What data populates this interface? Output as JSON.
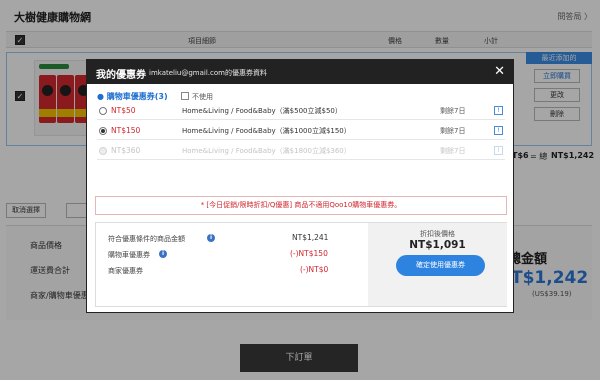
{
  "page": {
    "store_name": "大樹健康購物網",
    "store_link": "問答局 〉",
    "header": {
      "check": "✓",
      "item_info": "項目細節",
      "price": "價格",
      "quantity": "數量",
      "subtotal": "小計"
    },
    "item": {
      "check": "✓",
      "recent_tab": "最近添加的",
      "buy_now": "立即購買",
      "change": "更改",
      "delete": "刪除"
    },
    "total_line": {
      "prefix": "T$6",
      "equals": "= 總",
      "amount": "NT$1,242"
    },
    "deselect_button": "取消選擇",
    "summary": {
      "product_price": "商品價格",
      "shipping_total": "運送費合計",
      "store_coupon": "商家/購物車優惠",
      "grand_label": "總金額",
      "grand_amount": "T$1,242",
      "grand_usd": "(US$39.19)"
    },
    "order_button": "下訂單"
  },
  "modal": {
    "title": "我的優惠券",
    "email_text": "imkateliu@gmail.com的優惠券資料",
    "close": "✕",
    "section_title": "● 購物車優惠券(3)",
    "not_use": "不使用",
    "coupons": [
      {
        "code": "NT$50",
        "desc": "Home&Living / Food&Baby（滿$500立減$50）",
        "days": "剩餘7日",
        "selected": false,
        "disabled": false,
        "info": "!"
      },
      {
        "code": "NT$150",
        "desc": "Home&Living / Food&Baby（滿$1000立減$150）",
        "days": "剩餘7日",
        "selected": true,
        "disabled": false,
        "info": "!"
      },
      {
        "code": "NT$360",
        "desc": "Home&Living / Food&Baby（滿$1800立減$360）",
        "days": "剩餘7日",
        "selected": false,
        "disabled": true,
        "info": "!"
      }
    ],
    "notice": "* [今日促銷/限時折扣/Q優惠] 商品不適用Qoo10購物車優惠券。",
    "summary": {
      "eligible_label": "符合優惠條件的商品金額",
      "eligible_value": "NT$1,241",
      "cart_coupon_label": "購物車優惠券",
      "cart_coupon_value": "(-)NT$150",
      "store_coupon_label": "商家優惠券",
      "store_coupon_value": "(-)NT$0",
      "info_icon": "i",
      "final_label": "折扣後價格",
      "final_amount": "NT$1,091",
      "apply_button": "確定使用優惠券"
    }
  }
}
